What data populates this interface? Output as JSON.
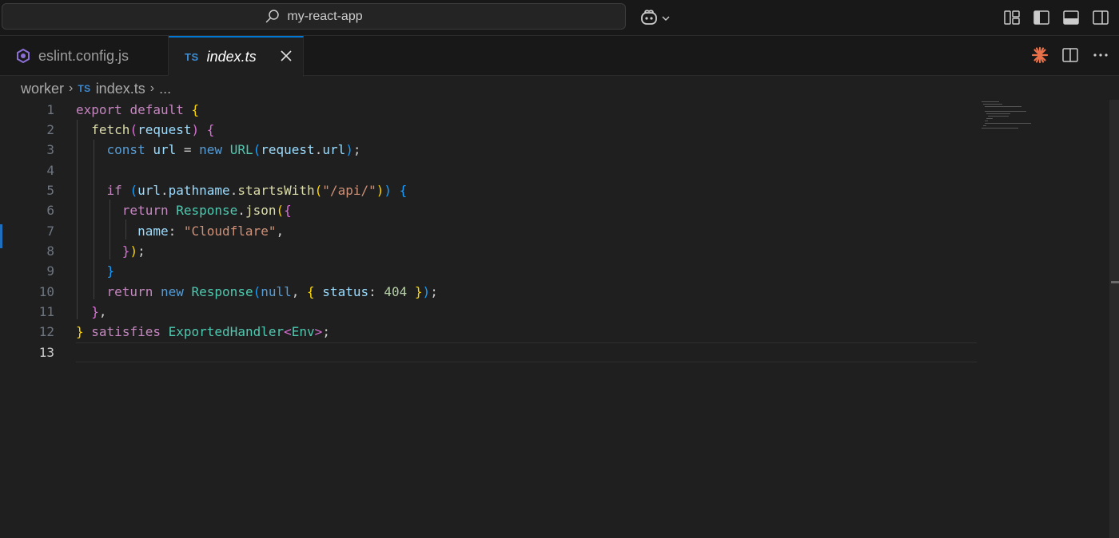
{
  "titlebar": {
    "search_label": "my-react-app"
  },
  "tabs": [
    {
      "label": "eslint.config.js",
      "icon": "eslint-icon",
      "active": false
    },
    {
      "label": "index.ts",
      "badge": "TS",
      "active": true
    }
  ],
  "breadcrumb": {
    "folder": "worker",
    "file_badge": "TS",
    "file": "index.ts",
    "more": "..."
  },
  "editor": {
    "current_line": 13,
    "line_numbers": [
      "1",
      "2",
      "3",
      "4",
      "5",
      "6",
      "7",
      "8",
      "9",
      "10",
      "11",
      "12",
      "13"
    ],
    "lines": [
      "export default {",
      "  fetch(request) {",
      "    const url = new URL(request.url);",
      "",
      "    if (url.pathname.startsWith(\"/api/\")) {",
      "      return Response.json({",
      "        name: \"Cloudflare\",",
      "      });",
      "    }",
      "    return new Response(null, { status: 404 });",
      "  },",
      "} satisfies ExportedHandler<Env>;",
      ""
    ]
  },
  "colors": {
    "accent": "#0078d4",
    "background": "#1f1f1f",
    "ts_badge": "#3c8cd6",
    "eslint": "#8b6fd6",
    "claude": "#e8714a"
  }
}
